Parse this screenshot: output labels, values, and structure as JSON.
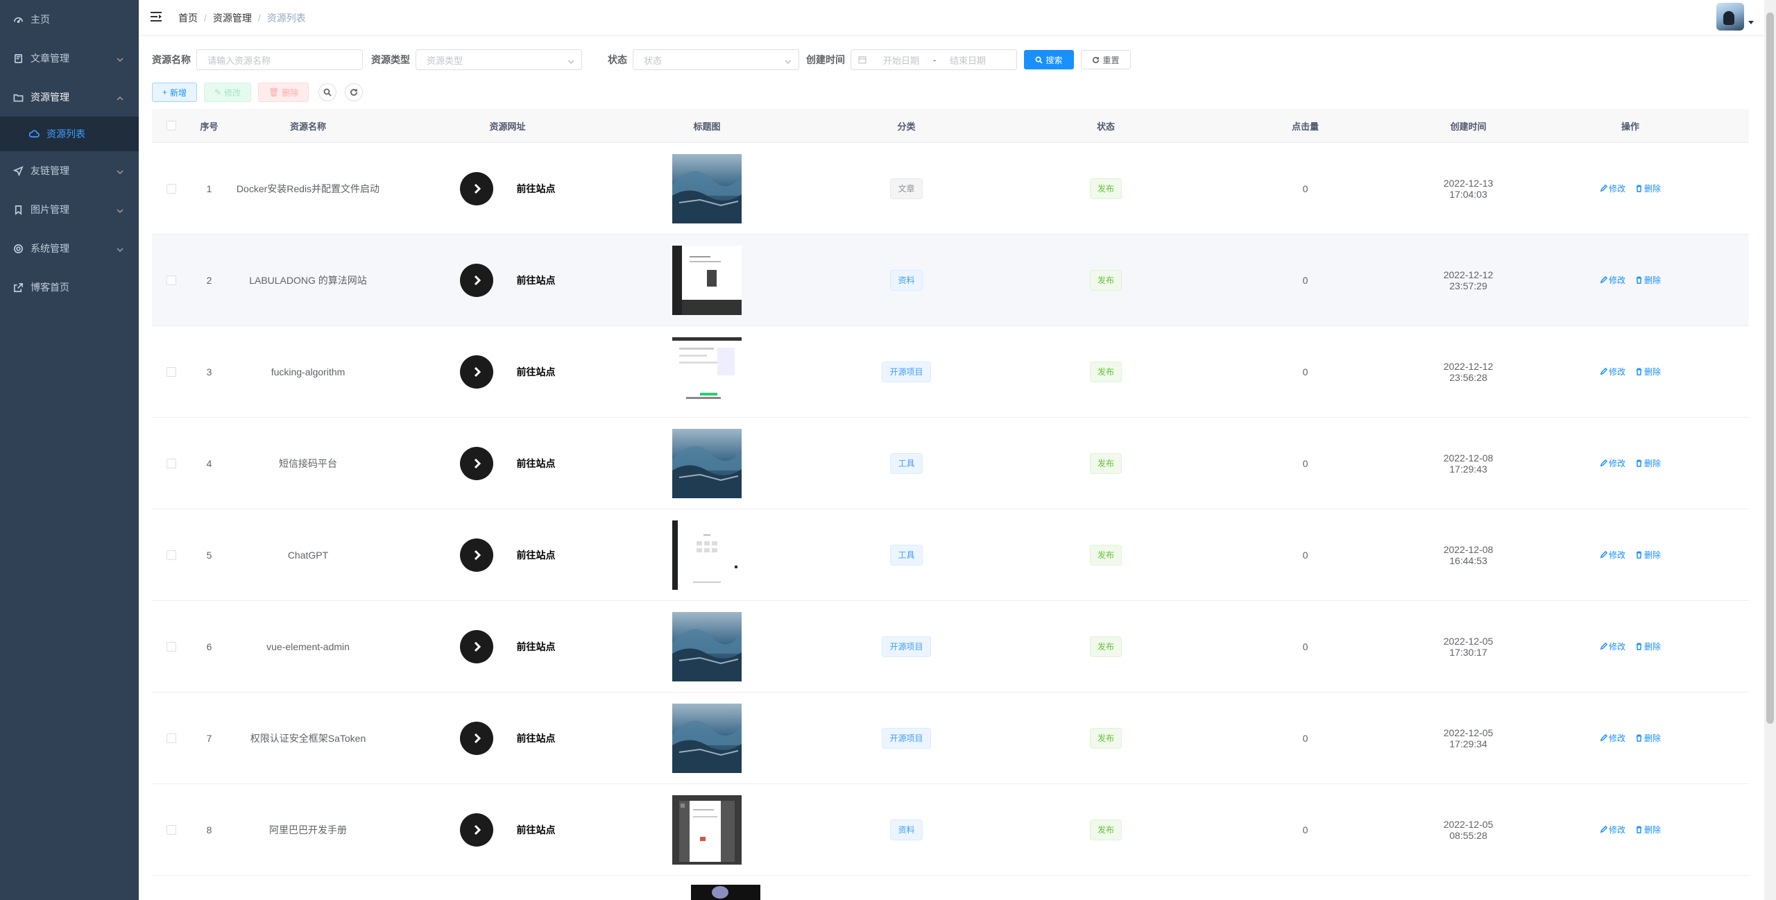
{
  "sidebar": {
    "items": [
      {
        "label": "主页",
        "icon": "dashboard-icon"
      },
      {
        "label": "文章管理",
        "icon": "document-icon"
      },
      {
        "label": "资源管理",
        "icon": "folder-icon"
      },
      {
        "label": "资源列表",
        "icon": "cloud-icon"
      },
      {
        "label": "友链管理",
        "icon": "send-icon"
      },
      {
        "label": "图片管理",
        "icon": "bookmark-icon"
      },
      {
        "label": "系统管理",
        "icon": "gear-icon"
      },
      {
        "label": "博客首页",
        "icon": "external-link-icon"
      }
    ]
  },
  "header": {
    "breadcrumb": [
      "首页",
      "资源管理",
      "资源列表"
    ]
  },
  "search": {
    "name_label": "资源名称",
    "name_placeholder": "请输入资源名称",
    "type_label": "资源类型",
    "type_placeholder": "资源类型",
    "status_label": "状态",
    "status_placeholder": "状态",
    "date_label": "创建时间",
    "date_start": "开始日期",
    "date_sep": "-",
    "date_end": "结束日期",
    "search_button": "搜索",
    "reset_button": "重置"
  },
  "toolbar": {
    "add": "新增",
    "edit": "修改",
    "delete": "删除"
  },
  "table": {
    "headers": [
      "序号",
      "资源名称",
      "资源网址",
      "标题图",
      "分类",
      "状态",
      "点击量",
      "创建时间",
      "操作"
    ],
    "link_text": "前往站点",
    "op_edit": "修改",
    "op_delete": "删除",
    "rows": [
      {
        "idx": "1",
        "name": "Docker安装Redis并配置文件启动",
        "category": "文章",
        "cat_style": "gray",
        "status": "发布",
        "clicks": "0",
        "time": "2022-12-13 17:04:03",
        "thumb": "wave"
      },
      {
        "idx": "2",
        "name": "LABULADONG 的算法网站",
        "category": "资料",
        "cat_style": "blue",
        "status": "发布",
        "clicks": "0",
        "time": "2022-12-12 23:57:29",
        "thumb": "site-dark"
      },
      {
        "idx": "3",
        "name": "fucking-algorithm",
        "category": "开源项目",
        "cat_style": "blue",
        "status": "发布",
        "clicks": "0",
        "time": "2022-12-12 23:56:28",
        "thumb": "site-light"
      },
      {
        "idx": "4",
        "name": "短信接码平台",
        "category": "工具",
        "cat_style": "blue",
        "status": "发布",
        "clicks": "0",
        "time": "2022-12-08 17:29:43",
        "thumb": "wave"
      },
      {
        "idx": "5",
        "name": "ChatGPT",
        "category": "工具",
        "cat_style": "blue",
        "status": "发布",
        "clicks": "0",
        "time": "2022-12-08 16:44:53",
        "thumb": "site-white"
      },
      {
        "idx": "6",
        "name": "vue-element-admin",
        "category": "开源项目",
        "cat_style": "blue",
        "status": "发布",
        "clicks": "0",
        "time": "2022-12-05 17:30:17",
        "thumb": "wave"
      },
      {
        "idx": "7",
        "name": "权限认证安全框架SaToken",
        "category": "开源项目",
        "cat_style": "blue",
        "status": "发布",
        "clicks": "0",
        "time": "2022-12-05 17:29:34",
        "thumb": "wave"
      },
      {
        "idx": "8",
        "name": "阿里巴巴开发手册",
        "category": "资料",
        "cat_style": "blue",
        "status": "发布",
        "clicks": "0",
        "time": "2022-12-05 08:55:28",
        "thumb": "site-gray"
      }
    ]
  }
}
